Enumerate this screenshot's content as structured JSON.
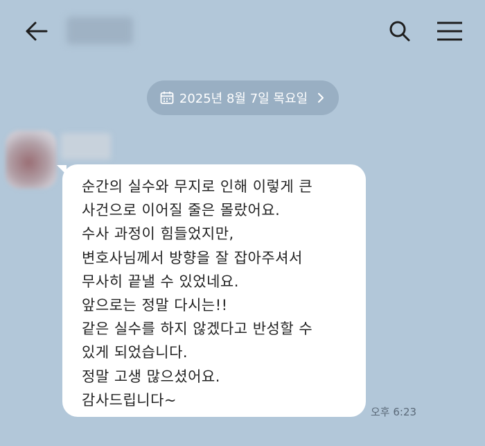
{
  "header": {
    "back_icon": "arrow-left-icon",
    "search_icon": "search-icon",
    "menu_icon": "hamburger-menu-icon"
  },
  "date_divider": {
    "text": "2025년 8월 7일 목요일",
    "icon": "calendar-icon",
    "chevron": "chevron-right-icon"
  },
  "message": {
    "lines": [
      "순간의 실수와 무지로 인해 이렇게 큰",
      "사건으로 이어질 줄은 몰랐어요.",
      "수사 과정이 힘들었지만,",
      "변호사님께서 방향을 잘 잡아주셔서",
      "무사히 끝낼 수 있었네요.",
      "앞으로는 정말 다시는!!",
      "같은 실수를 하지 않겠다고 반성할 수",
      "있게 되었습니다.",
      "정말 고생 많으셨어요.",
      "감사드립니다~"
    ],
    "time": "오후 6:23"
  },
  "colors": {
    "background": "#b2c7d9",
    "date_pill": "#99afc3",
    "bubble": "#ffffff",
    "text": "#222222"
  }
}
